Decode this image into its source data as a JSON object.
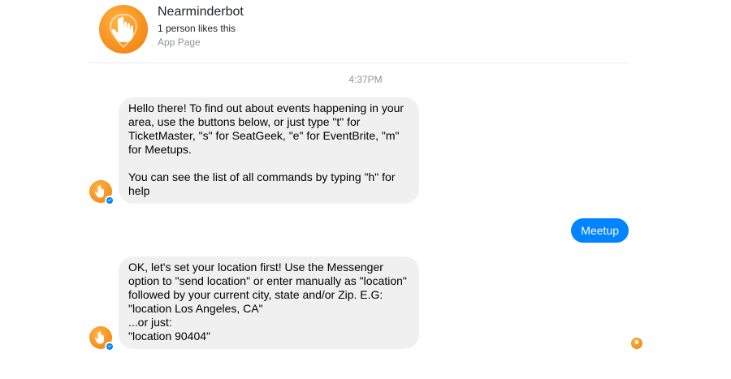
{
  "header": {
    "page_name": "Nearminderbot",
    "likes": "1 person likes this",
    "page_type": "App Page",
    "avatar_icon": "hand-pointer-location-icon"
  },
  "conversation": {
    "timestamp": "4:37PM",
    "messages": [
      {
        "from": "bot",
        "text": "Hello there! To find out about events happening in your area, use the buttons below, or just type \"t\" for TicketMaster, \"s\" for SeatGeek, \"e\" for EventBrite, \"m\" for Meetups.\n\nYou can see the list of all commands by typing \"h\" for help"
      },
      {
        "from": "user",
        "text": "Meetup"
      },
      {
        "from": "bot",
        "text": "OK, let's set your location first! Use the Messenger option to \"send location\" or enter manually as \"location\" followed by your current city, state and/or Zip. E.G:\n\"location Los Angeles, CA\"\n...or just:\n\"location 90404\""
      }
    ]
  },
  "colors": {
    "accent_orange": "#f7931e",
    "messenger_blue": "#0084ff",
    "bubble_gray": "#f1f0f0"
  }
}
